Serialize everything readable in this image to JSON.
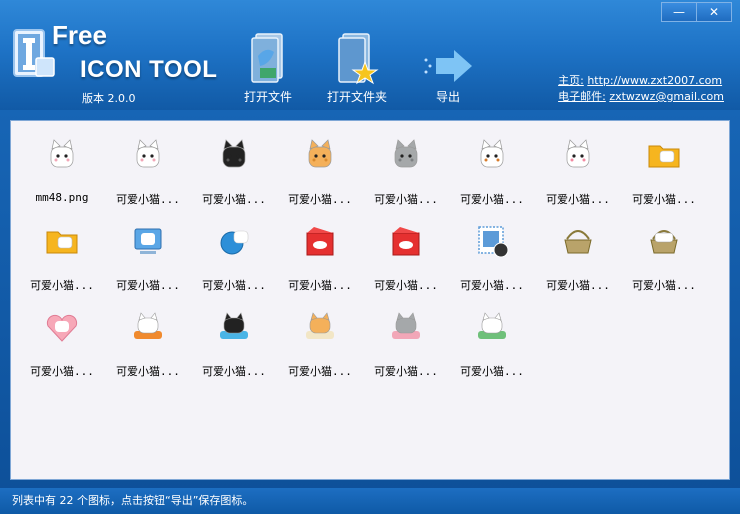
{
  "window": {
    "minimize_label": "—",
    "close_label": "✕"
  },
  "logo": {
    "line1": "Free",
    "line2": "ICON TOOL"
  },
  "version": "版本 2.0.0",
  "toolbar": {
    "open_file": "打开文件",
    "open_folder": "打开文件夹",
    "export": "导出"
  },
  "links": {
    "home_label": "主页:",
    "home_url": "http://www.zxt2007.com",
    "email_label": "电子邮件:",
    "email_value": "zxtwzwz@gmail.com"
  },
  "items": [
    {
      "label": "mm48.png",
      "icon": "cat-white-large"
    },
    {
      "label": "可爱小猫...",
      "icon": "cat-white"
    },
    {
      "label": "可爱小猫...",
      "icon": "cat-black"
    },
    {
      "label": "可爱小猫...",
      "icon": "cat-orange"
    },
    {
      "label": "可爱小猫...",
      "icon": "cat-gray"
    },
    {
      "label": "可爱小猫...",
      "icon": "cat-calico"
    },
    {
      "label": "可爱小猫...",
      "icon": "cat-white-pink"
    },
    {
      "label": "可爱小猫...",
      "icon": "folder-cat-yellow"
    },
    {
      "label": "可爱小猫...",
      "icon": "folder-cat-open"
    },
    {
      "label": "可爱小猫...",
      "icon": "computer-cat"
    },
    {
      "label": "可爱小猫...",
      "icon": "globe-cat"
    },
    {
      "label": "可爱小猫...",
      "icon": "red-box-fish"
    },
    {
      "label": "可爱小猫...",
      "icon": "red-box-cat"
    },
    {
      "label": "可爱小猫...",
      "icon": "stamp-cat"
    },
    {
      "label": "可爱小猫...",
      "icon": "basket-empty"
    },
    {
      "label": "可爱小猫...",
      "icon": "basket-cats"
    },
    {
      "label": "可爱小猫...",
      "icon": "heart-cat"
    },
    {
      "label": "可爱小猫...",
      "icon": "cat-on-orange-cushion"
    },
    {
      "label": "可爱小猫...",
      "icon": "cat-black-on-blue"
    },
    {
      "label": "可爱小猫...",
      "icon": "cat-orange-on-cushion"
    },
    {
      "label": "可爱小猫...",
      "icon": "cat-gray-on-pink"
    },
    {
      "label": "可爱小猫...",
      "icon": "cat-calico-on-green"
    }
  ],
  "status_text": "列表中有 22 个图标，点击按钮“导出”保存图标。",
  "colors": {
    "header_top": "#2f88d8",
    "header_bottom": "#115aa6",
    "content_bg": "#f4f3f8"
  }
}
